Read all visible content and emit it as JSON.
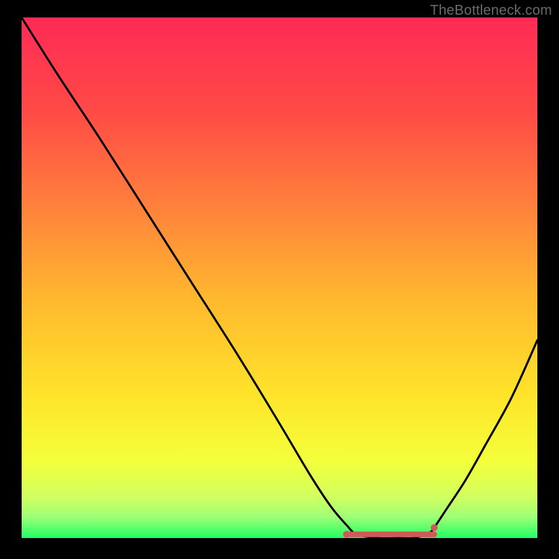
{
  "watermark": "TheBottleneck.com",
  "chart_data": {
    "type": "line",
    "title": "",
    "xlabel": "",
    "ylabel": "",
    "xlim": [
      0,
      100
    ],
    "ylim": [
      0,
      100
    ],
    "grid": false,
    "legend": false,
    "background_gradient": {
      "stops": [
        {
          "pos": 0.0,
          "color": "#ff2a55"
        },
        {
          "pos": 0.18,
          "color": "#ff4a46"
        },
        {
          "pos": 0.37,
          "color": "#ff833b"
        },
        {
          "pos": 0.55,
          "color": "#ffbb2e"
        },
        {
          "pos": 0.72,
          "color": "#ffe22a"
        },
        {
          "pos": 0.85,
          "color": "#f4ff3a"
        },
        {
          "pos": 0.92,
          "color": "#d2ff5f"
        },
        {
          "pos": 0.96,
          "color": "#9eff77"
        },
        {
          "pos": 1.0,
          "color": "#21ff64"
        }
      ]
    },
    "series": [
      {
        "name": "bottleneck-curve",
        "color": "#000000",
        "x": [
          0,
          7,
          15,
          24,
          33,
          42,
          50,
          56,
          60,
          63,
          65,
          69,
          73,
          76,
          79,
          80,
          82,
          86,
          90,
          95,
          100
        ],
        "y": [
          100,
          89,
          77,
          63,
          49,
          35,
          22,
          12,
          6,
          2.5,
          0.7,
          0,
          0,
          0,
          1.0,
          2.0,
          5,
          11,
          18,
          27,
          38
        ]
      }
    ],
    "highlight_segment": {
      "name": "flat-optimal-region",
      "color": "#cc5a5a",
      "x_start": 63,
      "x_end": 80,
      "y": 0.7,
      "thickness": 8,
      "endpoint_radius": 5
    }
  }
}
